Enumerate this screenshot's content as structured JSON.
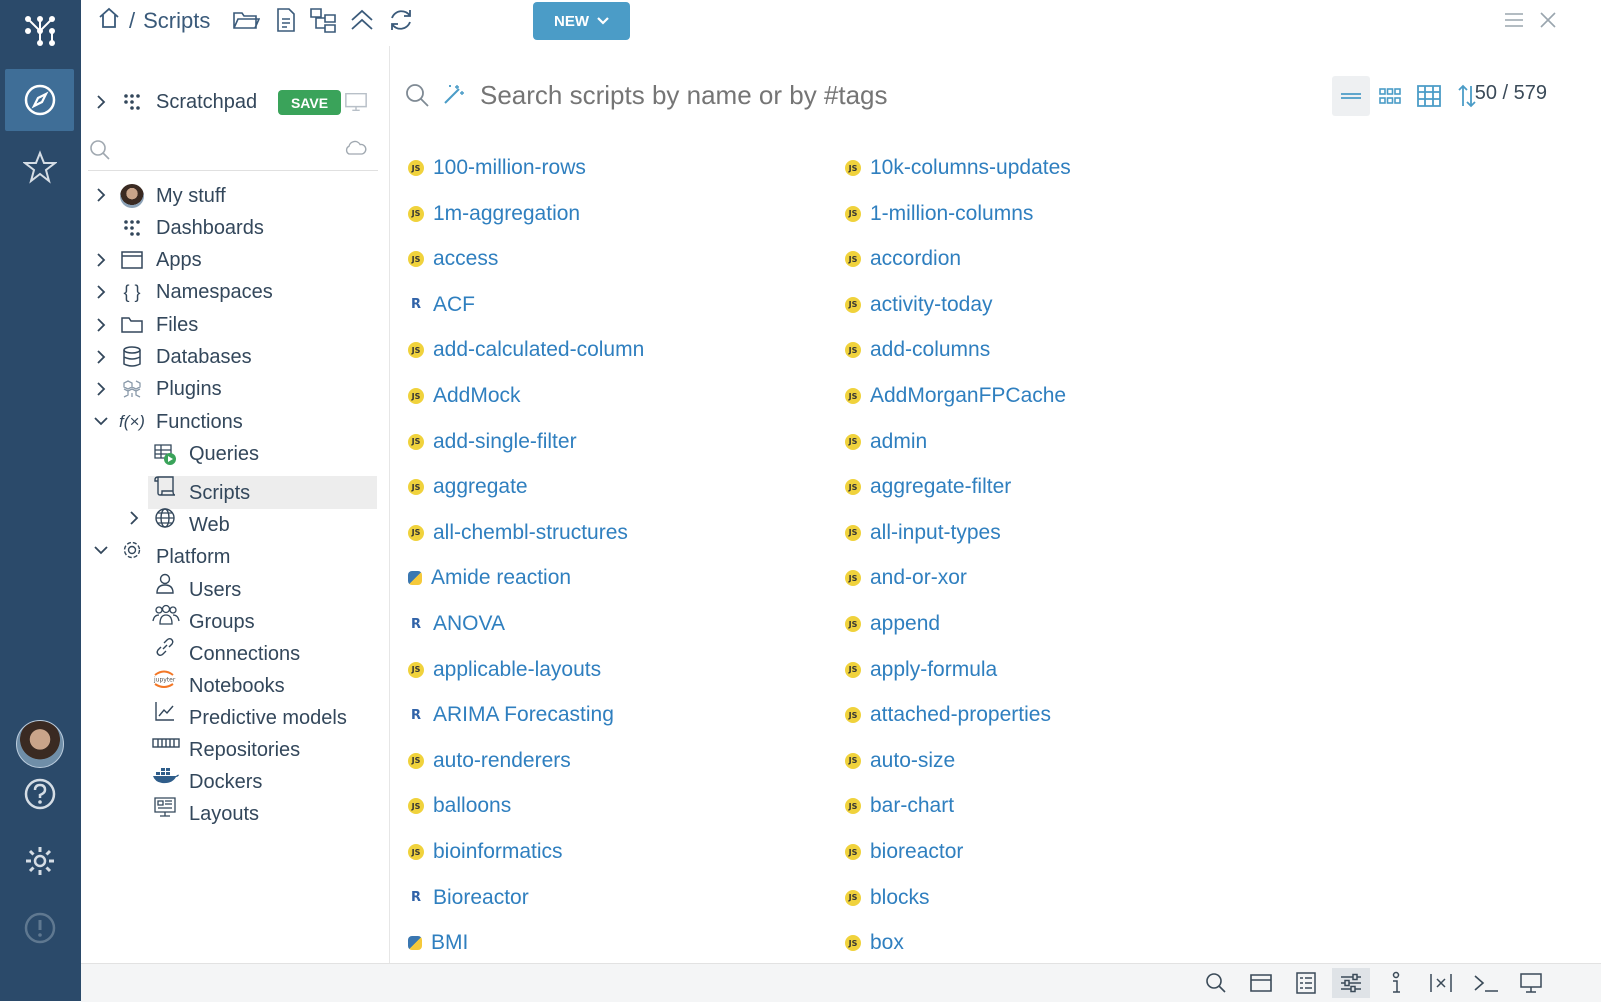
{
  "app": {
    "breadcrumb": {
      "separator": "/",
      "current": "Scripts"
    },
    "new_button_label": "NEW"
  },
  "tree": {
    "scratchpad_label": "Scratchpad",
    "save_label": "SAVE",
    "items": [
      {
        "label": "My stuff",
        "icon": "avatar-icon",
        "expanded": false
      },
      {
        "label": "Dashboards",
        "icon": "dashboards-icon"
      },
      {
        "label": "Apps",
        "icon": "apps-icon",
        "expanded": false
      },
      {
        "label": "Namespaces",
        "icon": "braces-icon",
        "expanded": false
      },
      {
        "label": "Files",
        "icon": "folder-icon",
        "expanded": false
      },
      {
        "label": "Databases",
        "icon": "database-icon",
        "expanded": false
      },
      {
        "label": "Plugins",
        "icon": "plugins-icon",
        "expanded": false
      },
      {
        "label": "Functions",
        "icon": "function-icon",
        "expanded": true
      },
      {
        "label": "Queries",
        "icon": "queries-icon"
      },
      {
        "label": "Scripts",
        "icon": "scroll-icon",
        "selected": true
      },
      {
        "label": "Web",
        "icon": "globe-icon",
        "expanded": false
      },
      {
        "label": "Platform",
        "icon": "gear-icon",
        "expanded": true
      },
      {
        "label": "Users",
        "icon": "user-icon"
      },
      {
        "label": "Groups",
        "icon": "group-icon"
      },
      {
        "label": "Connections",
        "icon": "link-icon"
      },
      {
        "label": "Notebooks",
        "icon": "jupyter-icon"
      },
      {
        "label": "Predictive models",
        "icon": "chart-line-icon"
      },
      {
        "label": "Repositories",
        "icon": "repository-icon"
      },
      {
        "label": "Dockers",
        "icon": "docker-icon"
      },
      {
        "label": "Layouts",
        "icon": "layout-icon"
      }
    ]
  },
  "search": {
    "placeholder": "Search scripts by name or by #tags"
  },
  "counter": "50 / 579",
  "scripts": {
    "col1": [
      {
        "name": "100-million-rows",
        "lang": "js"
      },
      {
        "name": "1m-aggregation",
        "lang": "js"
      },
      {
        "name": "access",
        "lang": "js"
      },
      {
        "name": "ACF",
        "lang": "r"
      },
      {
        "name": "add-calculated-column",
        "lang": "js"
      },
      {
        "name": "AddMock",
        "lang": "js"
      },
      {
        "name": "add-single-filter",
        "lang": "js"
      },
      {
        "name": "aggregate",
        "lang": "js"
      },
      {
        "name": "all-chembl-structures",
        "lang": "js"
      },
      {
        "name": "Amide reaction",
        "lang": "py"
      },
      {
        "name": "ANOVA",
        "lang": "r"
      },
      {
        "name": "applicable-layouts",
        "lang": "js"
      },
      {
        "name": "ARIMA Forecasting",
        "lang": "r"
      },
      {
        "name": "auto-renderers",
        "lang": "js"
      },
      {
        "name": "balloons",
        "lang": "js"
      },
      {
        "name": "bioinformatics",
        "lang": "js"
      },
      {
        "name": "Bioreactor",
        "lang": "r"
      },
      {
        "name": "BMI",
        "lang": "py"
      }
    ],
    "col2": [
      {
        "name": "10k-columns-updates",
        "lang": "js"
      },
      {
        "name": "1-million-columns",
        "lang": "js"
      },
      {
        "name": "accordion",
        "lang": "js"
      },
      {
        "name": "activity-today",
        "lang": "js"
      },
      {
        "name": "add-columns",
        "lang": "js"
      },
      {
        "name": "AddMorganFPCache",
        "lang": "js"
      },
      {
        "name": "admin",
        "lang": "js"
      },
      {
        "name": "aggregate-filter",
        "lang": "js"
      },
      {
        "name": "all-input-types",
        "lang": "js"
      },
      {
        "name": "and-or-xor",
        "lang": "js"
      },
      {
        "name": "append",
        "lang": "js"
      },
      {
        "name": "apply-formula",
        "lang": "js"
      },
      {
        "name": "attached-properties",
        "lang": "js"
      },
      {
        "name": "auto-size",
        "lang": "js"
      },
      {
        "name": "bar-chart",
        "lang": "js"
      },
      {
        "name": "bioreactor",
        "lang": "js"
      },
      {
        "name": "blocks",
        "lang": "js"
      },
      {
        "name": "box",
        "lang": "js"
      }
    ]
  },
  "lang_badges": {
    "js": "JS",
    "r": "R",
    "py": ""
  },
  "colors": {
    "sidebar": "#2b4a6a",
    "accent": "#4b9cc7",
    "link": "#2f7fbf",
    "save": "#3aa35a"
  }
}
